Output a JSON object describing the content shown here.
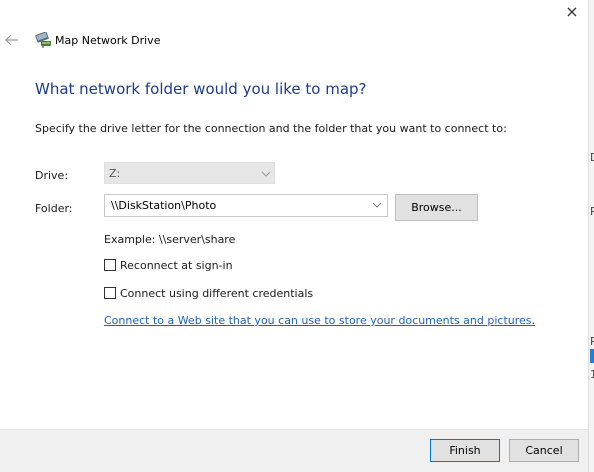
{
  "window": {
    "title": "Map Network Drive",
    "close_glyph": "×"
  },
  "main": {
    "heading": "What network folder would you like to map?",
    "instruction": "Specify the drive letter for the connection and the folder that you want to connect to:",
    "drive": {
      "label": "Drive:",
      "value": "Z:"
    },
    "folder": {
      "label": "Folder:",
      "value": "\\\\DiskStation\\Photo",
      "browse_label": "Browse..."
    },
    "example": "Example: \\\\server\\share",
    "options": [
      {
        "label": "Reconnect at sign-in",
        "checked": false
      },
      {
        "label": "Connect using different credentials",
        "checked": false
      }
    ],
    "link_text": "Connect to a Web site that you can use to store your documents and pictures",
    "link_suffix": "."
  },
  "footer": {
    "finish_label": "Finish",
    "cancel_label": "Cancel"
  },
  "background_window": {
    "fragments": [
      "D",
      "P",
      "R",
      "1"
    ]
  },
  "colors": {
    "heading": "#1d3d8c",
    "link": "#1f62b8",
    "accent": "#0078d7",
    "footer_bg": "#f0f0f0"
  },
  "icons": [
    "back-arrow-icon",
    "network-drive-icon",
    "close-icon",
    "chevron-down-icon"
  ]
}
